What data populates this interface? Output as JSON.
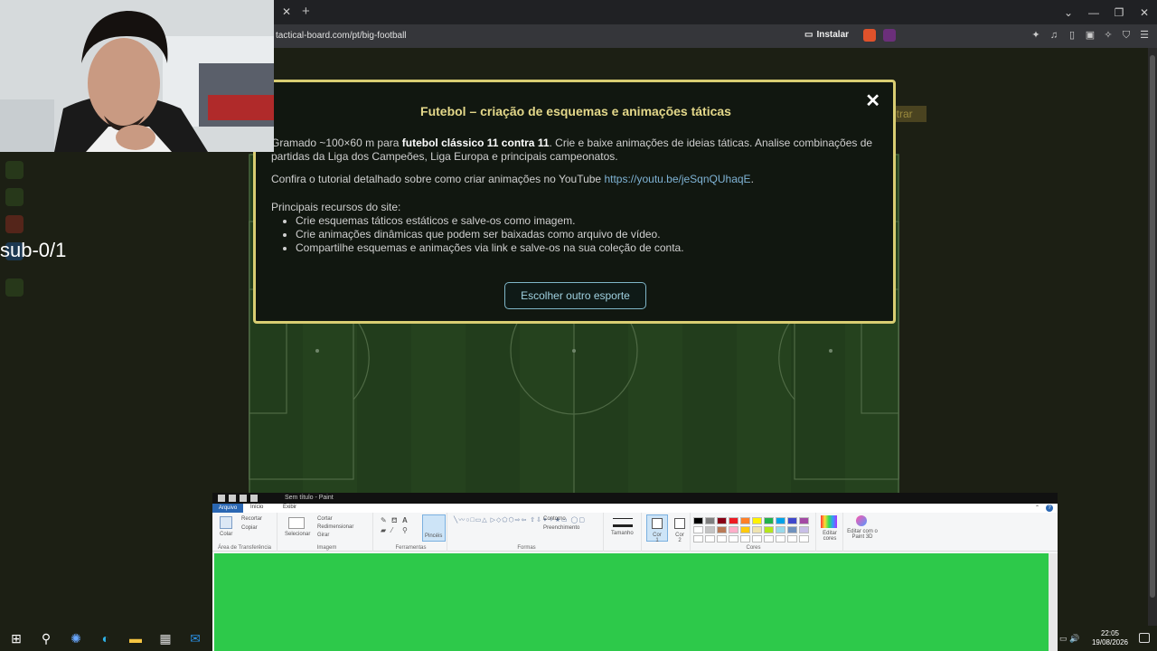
{
  "browser": {
    "url": "tactical-board.com/pt/big-football",
    "install_label": "Instalar",
    "tab_close": "✕",
    "new_tab": "+"
  },
  "overlay": {
    "sub_label": "sub-0/1",
    "bg_hint": "ntrar"
  },
  "modal": {
    "title": "Futebol – criação de esquemas e animações táticas",
    "close": "✕",
    "intro_pre": "Gramado ~100×60 m para ",
    "intro_bold": "futebol clássico 11 contra 11",
    "intro_post": ". Crie e baixe animações de ideias táticas. Analise combinações de partidas da Liga dos Campeões, Liga Europa e principais campeonatos.",
    "tutorial_pre": "Confira o tutorial detalhado sobre como criar animações no YouTube ",
    "tutorial_link": "https://youtu.be/jeSqnQUhaqE",
    "tutorial_post": ".",
    "features_heading": "Principais recursos do site:",
    "features": [
      "Crie esquemas táticos estáticos e salve-os como imagem.",
      "Crie animações dinâmicas que podem ser baixadas como arquivo de vídeo.",
      "Compartilhe esquemas e animações via link e salve-os na sua coleção de conta."
    ],
    "button": "Escolher outro esporte"
  },
  "paint": {
    "title": "Sem título - Paint",
    "menu": [
      "Arquivo",
      "Início",
      "Exibir"
    ],
    "groups": {
      "clipboard": "Área de Transferência",
      "image": "Imagem",
      "tools": "Ferramentas",
      "shapes": "Formas",
      "colors": "Cores"
    },
    "items": {
      "paste": "Colar",
      "cut": "Recortar",
      "copy": "Copiar",
      "select": "Selecionar",
      "crop": "Cortar",
      "resize": "Redimensionar",
      "rotate": "Girar",
      "brushes": "Pincéis",
      "outline": "Contorno",
      "fill": "Preenchimento",
      "size": "Tamanho",
      "color1": "Cor 1",
      "color2": "Cor 2",
      "edit_colors": "Editar cores",
      "paint3d": "Editar com o Paint 3D"
    },
    "palette": [
      "#000000",
      "#7f7f7f",
      "#880015",
      "#ed1c24",
      "#ff7f27",
      "#fff200",
      "#22b14c",
      "#00a2e8",
      "#3f48cc",
      "#a349a4",
      "#ffffff",
      "#c3c3c3",
      "#b97a57",
      "#ffaec9",
      "#ffc90e",
      "#efe4b0",
      "#b5e61d",
      "#99d9ea",
      "#7092be",
      "#c8bfe7",
      "#ffffff",
      "#ffffff",
      "#ffffff",
      "#ffffff",
      "#ffffff",
      "#ffffff",
      "#ffffff",
      "#ffffff",
      "#ffffff",
      "#ffffff"
    ],
    "canvas_color": "#2dc94a"
  },
  "taskbar": {
    "time": "22:05",
    "date": "19/08/2026"
  }
}
